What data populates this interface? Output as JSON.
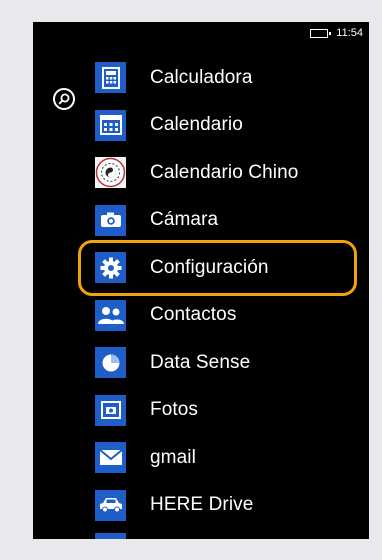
{
  "status_bar": {
    "time": "11:54"
  },
  "apps": [
    {
      "label": "Calculadora",
      "icon": "calculator-icon"
    },
    {
      "label": "Calendario",
      "icon": "calendar-icon"
    },
    {
      "label": "Calendario Chino",
      "icon": "chinese-calendar-icon"
    },
    {
      "label": "Cámara",
      "icon": "camera-icon"
    },
    {
      "label": "Configuración",
      "icon": "gear-icon",
      "highlighted": true
    },
    {
      "label": "Contactos",
      "icon": "people-icon"
    },
    {
      "label": "Data Sense",
      "icon": "pie-icon"
    },
    {
      "label": "Fotos",
      "icon": "photos-icon"
    },
    {
      "label": "gmail",
      "icon": "mail-icon"
    },
    {
      "label": "HERE Drive",
      "icon": "car-icon"
    }
  ],
  "colors": {
    "tile": "#1f5ec8",
    "highlight": "#f0a30a",
    "background": "#000000"
  }
}
